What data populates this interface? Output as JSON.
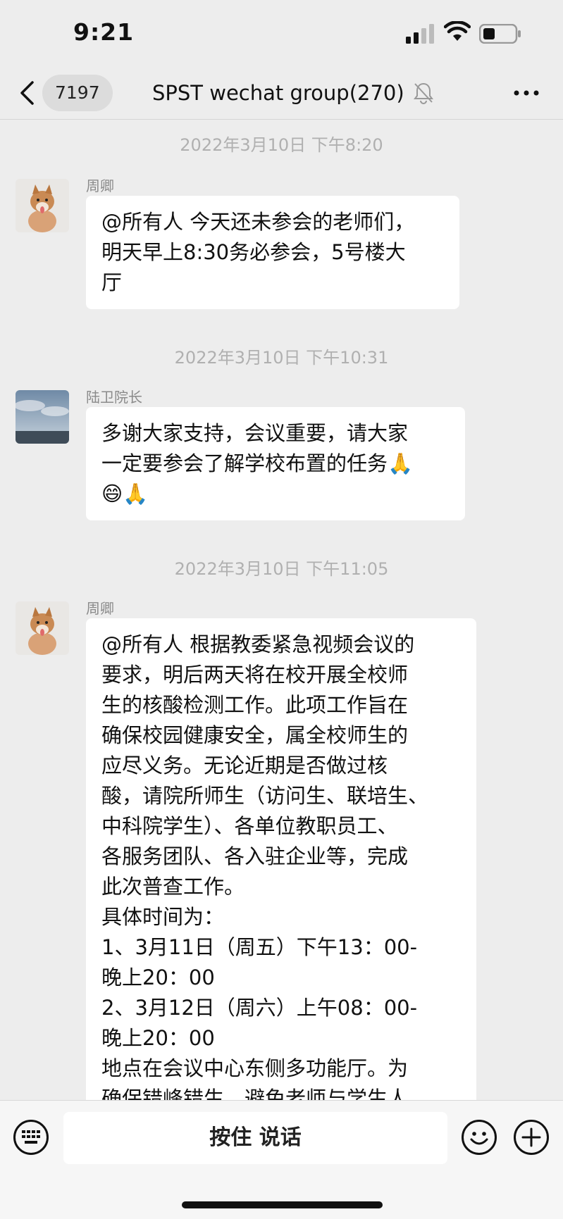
{
  "status_bar": {
    "time": "9:21"
  },
  "nav": {
    "unread_count": "7197",
    "title": "SPST wechat group(270)"
  },
  "messages": [
    {
      "timestamp": "2022年3月10日 下午8:20",
      "sender": "周卿",
      "lines": [
        "@所有人 今天还未参会的老师们，",
        "明天早上8:30务必参会，5号楼大",
        "厅"
      ]
    },
    {
      "timestamp": "2022年3月10日 下午10:31",
      "sender": "陆卫院长",
      "lines": [
        "多谢大家支持，会议重要，请大家",
        "一定要参会了解学校布置的任务🙏",
        "😄🙏"
      ]
    },
    {
      "timestamp": "2022年3月10日 下午11:05",
      "sender": "周卿",
      "lines": [
        "@所有人 根据教委紧急视频会议的",
        "要求，明后两天将在校开展全校师",
        "生的核酸检测工作。此项工作旨在",
        "确保校园健康安全，属全校师生的",
        "应尽义务。无论近期是否做过核",
        "酸，请院所师生（访问生、联培生、",
        "中科院学生）、各单位教职员工、",
        "各服务团队、各入驻企业等，完成",
        "此次普查工作。",
        "具体时间为：",
        "1、3月11日（周五）下午13：00-",
        "晚上20：00",
        "2、3月12日（周六）上午08：00-",
        "晚上20：00",
        "地点在会议中心东侧多功能厅。为",
        "确保错峰错生，避免老师与学生人"
      ]
    }
  ],
  "input_bar": {
    "hold_to_talk": "按住 说话"
  },
  "icons": {
    "back": "chevron-left-icon",
    "mute": "bell-muted-icon",
    "more": "more-dots-icon",
    "keyboard": "keyboard-icon",
    "emoji": "emoji-icon",
    "add": "plus-circle-icon"
  }
}
